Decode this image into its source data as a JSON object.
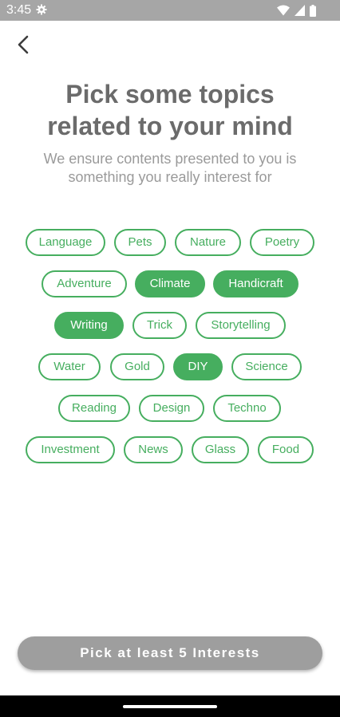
{
  "status_bar": {
    "time": "3:45"
  },
  "header": {
    "title": "Pick some topics\nrelated to your mind",
    "subtitle": "We ensure contents presented to you is\nsomething you really interest for"
  },
  "topics": [
    {
      "label": "Language",
      "selected": false
    },
    {
      "label": "Pets",
      "selected": false
    },
    {
      "label": "Nature",
      "selected": false
    },
    {
      "label": "Poetry",
      "selected": false
    },
    {
      "label": "Adventure",
      "selected": false
    },
    {
      "label": "Climate",
      "selected": true
    },
    {
      "label": "Handicraft",
      "selected": true
    },
    {
      "label": "Writing",
      "selected": true
    },
    {
      "label": "Trick",
      "selected": false
    },
    {
      "label": "Storytelling",
      "selected": false
    },
    {
      "label": "Water",
      "selected": false
    },
    {
      "label": "Gold",
      "selected": false
    },
    {
      "label": "DIY",
      "selected": true
    },
    {
      "label": "Science",
      "selected": false
    },
    {
      "label": "Reading",
      "selected": false
    },
    {
      "label": "Design",
      "selected": false
    },
    {
      "label": "Techno",
      "selected": false
    },
    {
      "label": "Investment",
      "selected": false
    },
    {
      "label": "News",
      "selected": false
    },
    {
      "label": "Glass",
      "selected": false
    },
    {
      "label": "Food",
      "selected": false
    }
  ],
  "colors": {
    "accent": "#46ae5f",
    "button_disabled": "#9e9e9e"
  },
  "footer": {
    "cta_label": "Pick at least 5 Interests"
  }
}
